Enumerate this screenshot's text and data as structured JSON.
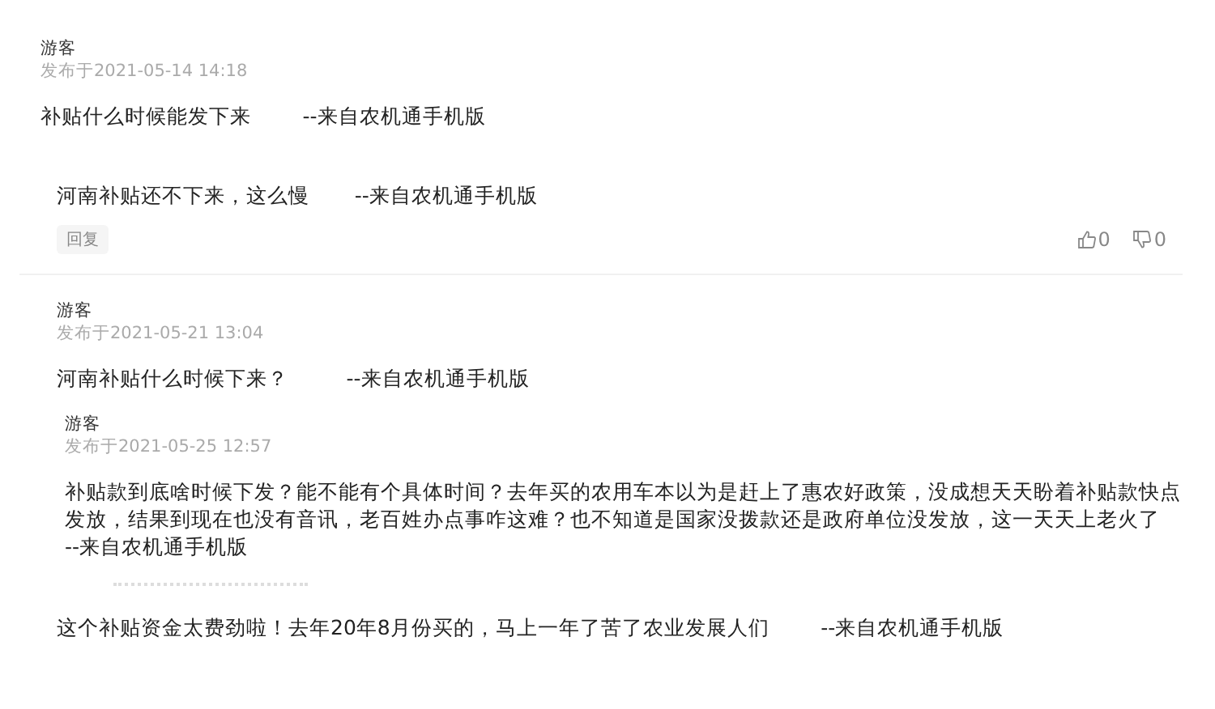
{
  "comments": [
    {
      "author": "游客",
      "time": "发布于2021-05-14 14:18",
      "text": "补贴什么时候能发下来        --来自农机通手机版",
      "followup": "河南补贴还不下来，这么慢       --来自农机通手机版",
      "actions": {
        "reply": "回复",
        "likes": "0",
        "dislikes": "0"
      }
    },
    {
      "author": "游客",
      "time": "发布于2021-05-21 13:04",
      "text": "河南补贴什么时候下来？         --来自农机通手机版",
      "replies": [
        {
          "author": "游客",
          "time": "发布于2021-05-25 12:57",
          "text": "补贴款到底啥时候下发？能不能有个具体时间？去年买的农用车本以为是赶上了惠农好政策，没成想天天盼着补贴款快点发放，结果到现在也没有音讯，老百姓办点事咋这难？也不知道是国家没拨款还是政府单位没发放，这一天天上老火了        --来自农机通手机版"
        }
      ]
    },
    {
      "text": "这个补贴资金太费劲啦！去年20年8月份买的，马上一年了苦了农业发展人们        --来自农机通手机版"
    }
  ]
}
